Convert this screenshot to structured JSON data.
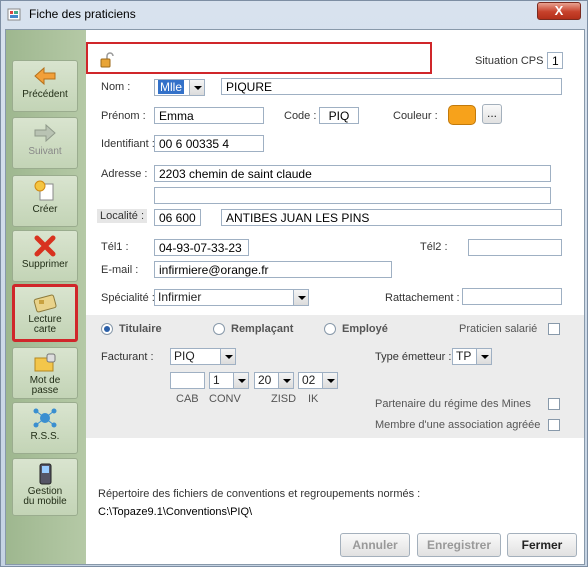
{
  "window": {
    "title": "Fiche des praticiens",
    "close": "X"
  },
  "sidebar": [
    {
      "label": "Précédent"
    },
    {
      "label": "Suivant"
    },
    {
      "label": "Créer"
    },
    {
      "label": "Supprimer"
    },
    {
      "label": "Lecture carte"
    },
    {
      "label": "Mot de passe"
    },
    {
      "label": "R.S.S."
    },
    {
      "label": "Gestion du mobile"
    }
  ],
  "form": {
    "situation_cps_label": "Situation CPS :",
    "situation_cps": "1",
    "nom_label": "Nom :",
    "civilite": "Mlle",
    "nom": "PIQURE",
    "prenom_label": "Prénom :",
    "prenom": "Emma",
    "code_label": "Code :",
    "code": "PIQ",
    "couleur_label": "Couleur :",
    "couleur_value": "#f7a21b",
    "couleur_btn": "...",
    "identifiant_label": "Identifiant :",
    "identifiant": "00 6 00335 4",
    "adresse_label": "Adresse :",
    "adresse1": "2203 chemin de saint claude",
    "adresse2": "",
    "localite_label": "Localité :",
    "cp": "06 600",
    "ville": "ANTIBES JUAN LES PINS",
    "tel1_label": "Tél1 :",
    "tel1": "04-93-07-33-23",
    "tel2_label": "Tél2 :",
    "tel2": "",
    "email_label": "E-mail :",
    "email": "infirmiere@orange.fr",
    "specialite_label": "Spécialité :",
    "specialite": "Infirmier",
    "rattachement_label": "Rattachement :",
    "rattachement": "",
    "status": {
      "titulaire": "Titulaire",
      "remplacant": "Remplaçant",
      "employe": "Employé"
    },
    "salarie_label": "Praticien salarié",
    "facturant_label": "Facturant :",
    "facturant": "PIQ",
    "type_emetteur_label": "Type émetteur :",
    "type_emetteur": "TP",
    "cab": "",
    "conv": "1",
    "zisd": "20",
    "ik": "02",
    "cab_label": "CAB",
    "conv_label": "CONV",
    "zisd_label": "ZISD",
    "ik_label": "IK",
    "mines_label": "Partenaire du régime des Mines",
    "agreee_label": "Membre d'une association agréée",
    "repertoire_label": "Répertoire des fichiers de conventions et regroupements normés :",
    "repertoire_path": "C:\\Topaze9.1\\Conventions\\PIQ\\"
  },
  "buttons": {
    "annuler": "Annuler",
    "enregistrer": "Enregistrer",
    "fermer": "Fermer"
  }
}
